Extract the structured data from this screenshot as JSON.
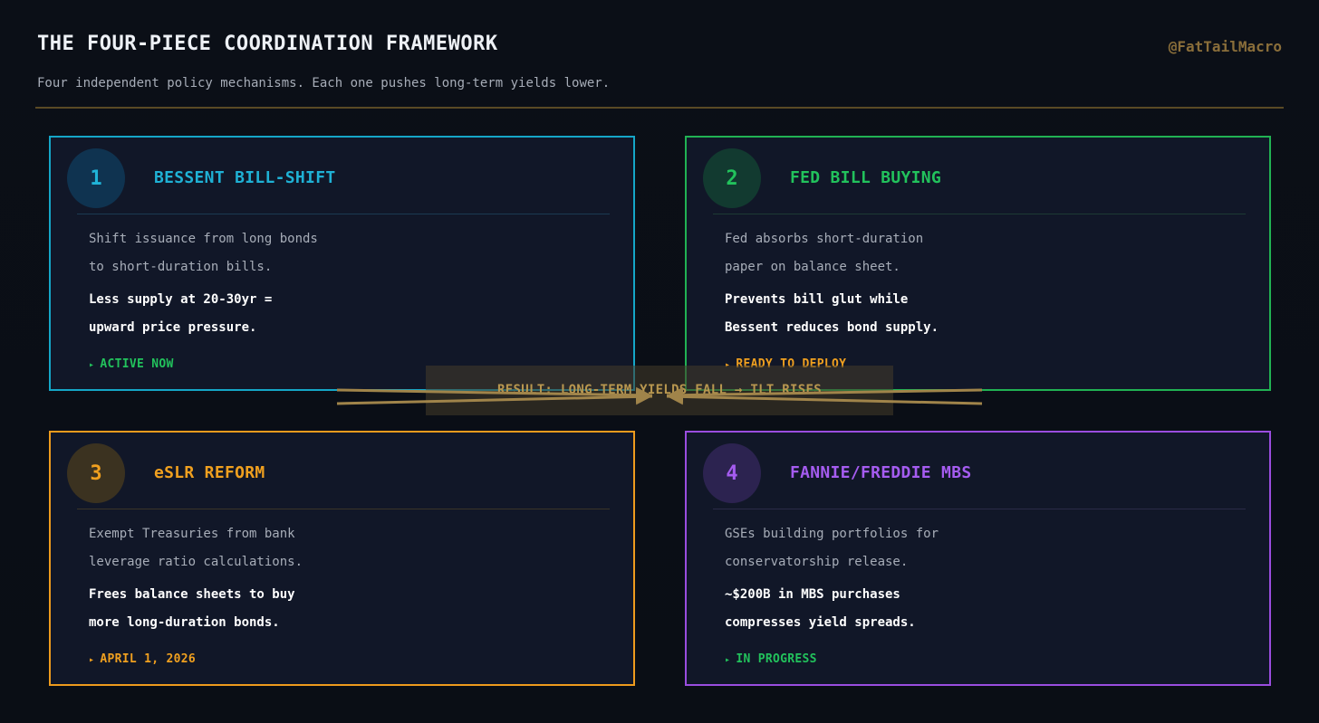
{
  "header": {
    "title": "THE FOUR-PIECE COORDINATION FRAMEWORK",
    "subtitle": "Four independent policy mechanisms. Each one pushes long-term yields lower.",
    "handle": "@FatTailMacro"
  },
  "cards": [
    {
      "number": "1",
      "title": "BESSENT BILL-SHIFT",
      "description": [
        "Shift issuance from long bonds",
        "to short-duration bills."
      ],
      "emphasis": [
        "Less supply at 20-30yr =",
        "upward price pressure."
      ],
      "status": "ACTIVE NOW",
      "status_color": "#22c25c",
      "accent": "#15a6c7"
    },
    {
      "number": "2",
      "title": "FED BILL BUYING",
      "description": [
        "Fed absorbs short-duration",
        "paper on balance sheet."
      ],
      "emphasis": [
        "Prevents bill glut while",
        "Bessent reduces bond supply."
      ],
      "status": "READY TO DEPLOY",
      "status_color": "#f0a01f",
      "accent": "#21b253"
    },
    {
      "number": "3",
      "title": "eSLR REFORM",
      "description": [
        "Exempt Treasuries from bank",
        "leverage ratio calculations."
      ],
      "emphasis": [
        "Frees balance sheets to buy",
        "more long-duration bonds."
      ],
      "status": "APRIL 1, 2026",
      "status_color": "#f0a01f",
      "accent": "#ee9b1d"
    },
    {
      "number": "4",
      "title": "FANNIE/FREDDIE MBS",
      "description": [
        "GSEs building portfolios for",
        "conservatorship release."
      ],
      "emphasis": [
        "~$200B in MBS purchases",
        "compresses yield spreads."
      ],
      "status": "IN PROGRESS",
      "status_color": "#22c25c",
      "accent": "#9a4ddf"
    }
  ],
  "result": {
    "text": "RESULT: LONG-TERM YIELDS FALL → TLT RISES",
    "color": "#b8974f"
  },
  "icons": {
    "status_marker": "triangle-right-icon"
  }
}
